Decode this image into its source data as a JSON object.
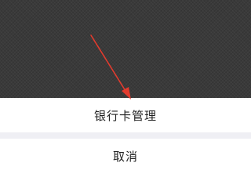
{
  "action_sheet": {
    "options": [
      {
        "label": "银行卡管理"
      }
    ],
    "cancel_label": "取消"
  },
  "annotation": {
    "type": "arrow",
    "color": "#e23b2e"
  },
  "colors": {
    "overlay": "#3a3a3a",
    "sheet_background": "#efeff4",
    "option_background": "#ffffff",
    "text": "#222222"
  }
}
